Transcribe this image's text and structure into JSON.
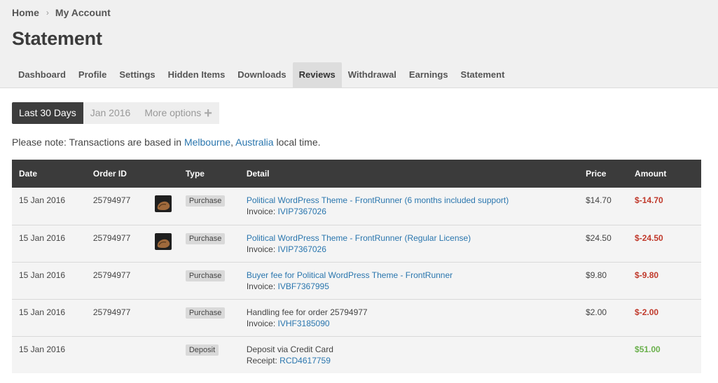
{
  "breadcrumb": {
    "home": "Home",
    "sep": "›",
    "current": "My Account"
  },
  "page_title": "Statement",
  "tabs": [
    {
      "label": "Dashboard"
    },
    {
      "label": "Profile"
    },
    {
      "label": "Settings"
    },
    {
      "label": "Hidden Items"
    },
    {
      "label": "Downloads"
    },
    {
      "label": "Reviews"
    },
    {
      "label": "Withdrawal"
    },
    {
      "label": "Earnings"
    },
    {
      "label": "Statement"
    }
  ],
  "filters": {
    "last30": "Last 30 Days",
    "jan": "Jan 2016",
    "more": "More options",
    "plus": "+"
  },
  "note": {
    "prefix": "Please note: Transactions are based in ",
    "city": "Melbourne",
    "comma": ", ",
    "country": "Australia",
    "suffix": " local time."
  },
  "table": {
    "headers": {
      "date": "Date",
      "order": "Order ID",
      "type": "Type",
      "detail": "Detail",
      "price": "Price",
      "amount": "Amount"
    },
    "rows": [
      {
        "date": "15 Jan 2016",
        "order": "25794977",
        "thumb": "theme-thumbnail",
        "type": "Purchase",
        "detail": "Political WordPress Theme - FrontRunner (6 months included support)",
        "ref_label": "Invoice: ",
        "ref": "IVIP7367026",
        "price": "$14.70",
        "amount": "$-14.70"
      },
      {
        "date": "15 Jan 2016",
        "order": "25794977",
        "thumb": "theme-thumbnail",
        "type": "Purchase",
        "detail": "Political WordPress Theme - FrontRunner (Regular License)",
        "ref_label": "Invoice: ",
        "ref": "IVIP7367026",
        "price": "$24.50",
        "amount": "$-24.50"
      },
      {
        "date": "15 Jan 2016",
        "order": "25794977",
        "type": "Purchase",
        "detail": "Buyer fee for Political WordPress Theme - FrontRunner",
        "ref_label": "Invoice: ",
        "ref": "IVBF7367995",
        "price": "$9.80",
        "amount": "$-9.80"
      },
      {
        "date": "15 Jan 2016",
        "order": "25794977",
        "type": "Purchase",
        "detail": "Handling fee for order 25794977",
        "ref_label": "Invoice: ",
        "ref": "IVHF3185090",
        "price": "$2.00",
        "amount": "$-2.00"
      },
      {
        "date": "15 Jan 2016",
        "order": "",
        "type": "Deposit",
        "detail": "Deposit via Credit Card",
        "ref_label": "Receipt: ",
        "ref": "RCD4617759",
        "price": "",
        "amount": "$51.00"
      }
    ]
  },
  "colors": {
    "negative": "#c0392b",
    "positive": "#6ab04c",
    "link": "#2a76ae",
    "header_bg": "#3b3b3b"
  }
}
